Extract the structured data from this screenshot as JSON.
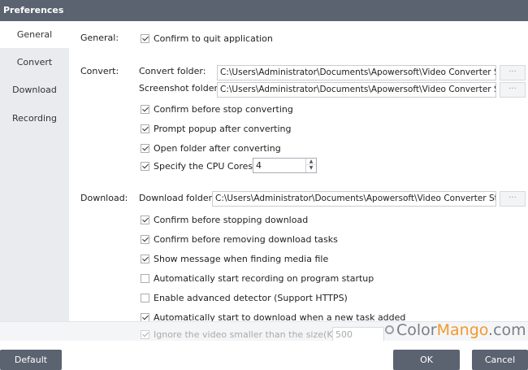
{
  "window": {
    "title": "Preferences"
  },
  "sidebar": {
    "items": [
      {
        "label": "General",
        "active": true
      },
      {
        "label": "Convert",
        "active": false
      },
      {
        "label": "Download",
        "active": false
      },
      {
        "label": "Recording",
        "active": false
      }
    ]
  },
  "general": {
    "section_label": "General:",
    "confirm_quit": {
      "label": "Confirm to quit application",
      "checked": true
    }
  },
  "convert": {
    "section_label": "Convert:",
    "convert_folder_label": "Convert folder:",
    "convert_folder_value": "C:\\Users\\Administrator\\Documents\\Apowersoft\\Video Converter Stu",
    "screenshot_folder_label": "Screenshot folder:",
    "screenshot_folder_value": "C:\\Users\\Administrator\\Documents\\Apowersoft\\Video Converter Stu",
    "browse_label": "···",
    "confirm_stop": {
      "label": "Confirm before stop converting",
      "checked": true
    },
    "prompt_popup": {
      "label": "Prompt popup after converting",
      "checked": true
    },
    "open_folder": {
      "label": "Open folder after converting",
      "checked": true
    },
    "cpu_cores": {
      "label": "Specify the CPU Cores:",
      "checked": true,
      "value": "4"
    }
  },
  "download": {
    "section_label": "Download:",
    "download_folder_label": "Download folder:",
    "download_folder_value": "C:\\Users\\Administrator\\Documents\\Apowersoft\\Video Converter Stuc",
    "browse_label": "···",
    "confirm_stopping": {
      "label": "Confirm before stopping download",
      "checked": true
    },
    "confirm_removing": {
      "label": "Confirm before removing download tasks",
      "checked": true
    },
    "show_message": {
      "label": "Show message when finding media file",
      "checked": true
    },
    "auto_record": {
      "label": "Automatically start recording on program startup",
      "checked": false
    },
    "advanced_detector": {
      "label": "Enable advanced detector (Support HTTPS)",
      "checked": false
    },
    "auto_download": {
      "label": "Automatically start to download when a new task added",
      "checked": true
    },
    "ignore_small": {
      "label": "Ignore the video smaller than the size(KB):",
      "checked": true,
      "value": "500"
    }
  },
  "footer": {
    "default_label": "Default",
    "ok_label": "OK",
    "cancel_label": "Cancel"
  },
  "watermark": {
    "part1": "Color",
    "part2": "Mango",
    "part3": ".com"
  },
  "colors": {
    "titlebar": "#5b6270",
    "sidebar": "#eaebee",
    "button": "#5b6270",
    "watermark_accent": "#f09a2c"
  }
}
